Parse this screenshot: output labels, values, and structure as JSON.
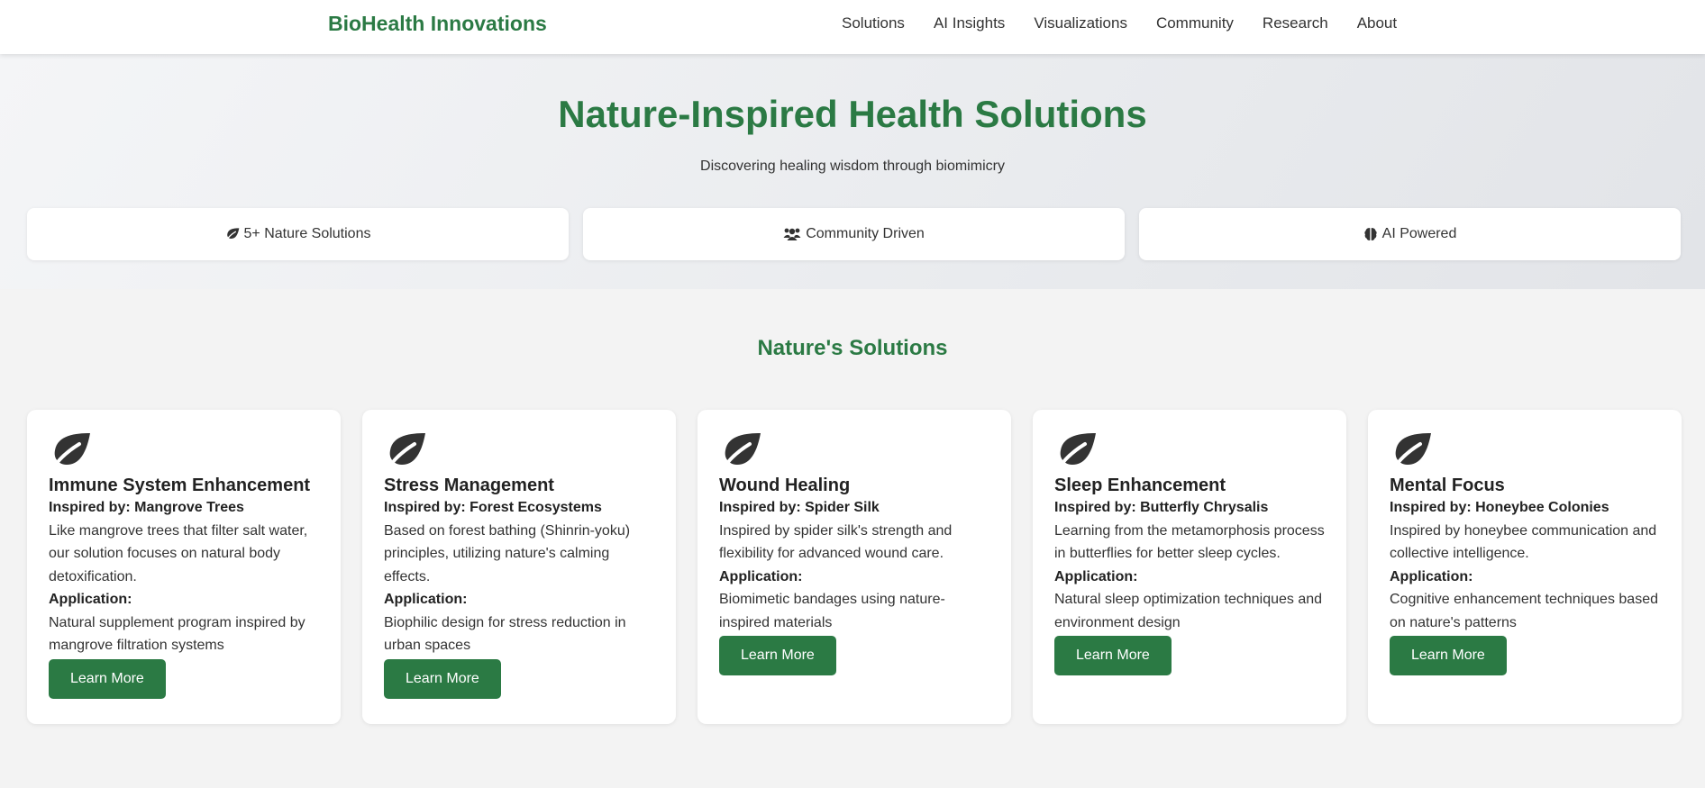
{
  "header": {
    "brand": "BioHealth Innovations",
    "nav": [
      "Solutions",
      "AI Insights",
      "Visualizations",
      "Community",
      "Research",
      "About"
    ]
  },
  "hero": {
    "title": "Nature-Inspired Health Solutions",
    "subtitle": "Discovering healing wisdom through biomimicry",
    "stats": [
      {
        "icon": "leaf-icon",
        "label": "5+ Nature Solutions"
      },
      {
        "icon": "users-icon",
        "label": "Community Driven"
      },
      {
        "icon": "brain-icon",
        "label": "AI Powered"
      }
    ]
  },
  "solutions": {
    "title": "Nature's Solutions",
    "application_label": "Application:",
    "button_label": "Learn More",
    "cards": [
      {
        "icon": "leaf-icon",
        "title": "Immune System Enhancement",
        "inspired": "Inspired by: Mangrove Trees",
        "description": "Like mangrove trees that filter salt water, our solution focuses on natural body detoxification.",
        "application": "Natural supplement program inspired by mangrove filtration systems"
      },
      {
        "icon": "leaf-icon",
        "title": "Stress Management",
        "inspired": "Inspired by: Forest Ecosystems",
        "description": "Based on forest bathing (Shinrin-yoku) principles, utilizing nature's calming effects.",
        "application": "Biophilic design for stress reduction in urban spaces"
      },
      {
        "icon": "leaf-icon",
        "title": "Wound Healing",
        "inspired": "Inspired by: Spider Silk",
        "description": "Inspired by spider silk's strength and flexibility for advanced wound care.",
        "application": "Biomimetic bandages using nature-inspired materials"
      },
      {
        "icon": "leaf-icon",
        "title": "Sleep Enhancement",
        "inspired": "Inspired by: Butterfly Chrysalis",
        "description": "Learning from the metamorphosis process in butterflies for better sleep cycles.",
        "application": "Natural sleep optimization techniques and environment design"
      },
      {
        "icon": "leaf-icon",
        "title": "Mental Focus",
        "inspired": "Inspired by: Honeybee Colonies",
        "description": "Inspired by honeybee communication and collective intelligence.",
        "application": "Cognitive enhancement techniques based on nature's patterns"
      }
    ]
  },
  "colors": {
    "brand_green": "#2b7a44",
    "background": "#f3f3f3",
    "card": "#ffffff"
  }
}
